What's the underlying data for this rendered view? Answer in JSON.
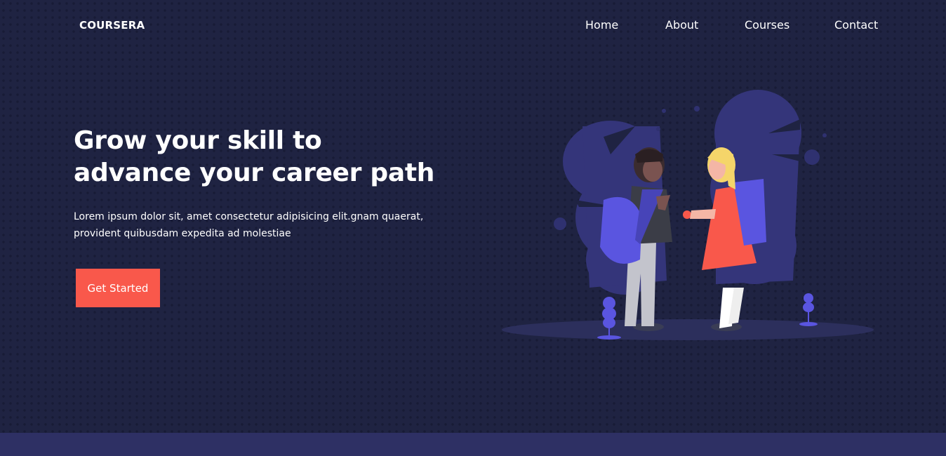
{
  "brand": {
    "logo": "COURSERA"
  },
  "nav": {
    "items": [
      {
        "label": "Home"
      },
      {
        "label": "About"
      },
      {
        "label": "Courses"
      },
      {
        "label": "Contact"
      }
    ]
  },
  "hero": {
    "title_line1": "Grow your skill to",
    "title_line2": "advance your career path",
    "description_line1": "Lorem ipsum dolor sit, amet consectetur adipisicing elit.gnam quaerat,",
    "description_line2": "provident quibusdam expedita ad molestiae",
    "cta_label": "Get Started",
    "illustration": "students-with-backpacks-illustration"
  },
  "colors": {
    "background": "#1f2342",
    "accent": "#f9584b",
    "illustration_purple": "#5a55e0",
    "bottom_bar": "#2e3064"
  }
}
